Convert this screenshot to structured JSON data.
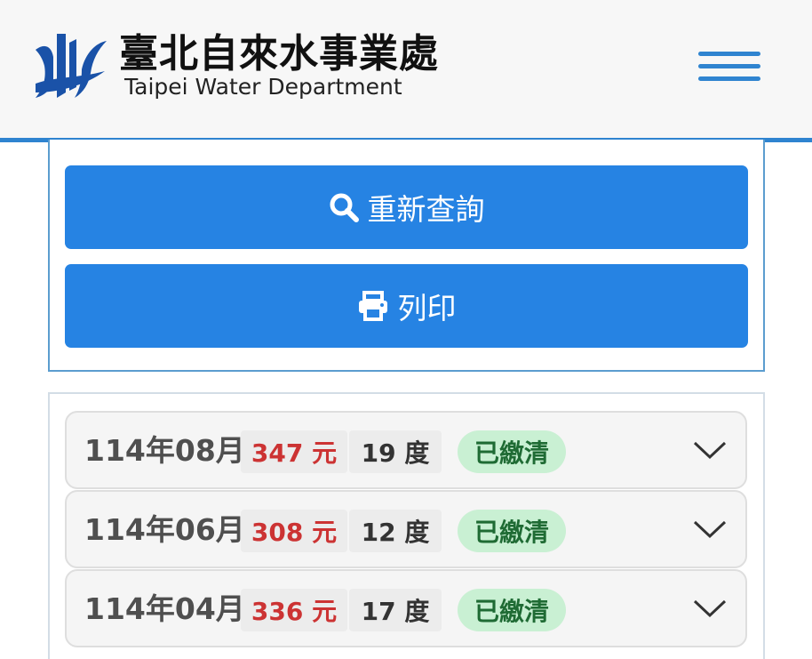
{
  "header": {
    "title_zh": "臺北自來水事業處",
    "title_en": "Taipei Water Department",
    "icons": {
      "logo": "water-department-logo",
      "menu": "hamburger-menu-icon"
    },
    "colors": {
      "accent": "#2f84d0"
    }
  },
  "actions": {
    "search_label": "重新查詢",
    "search_icon": "search-icon",
    "print_label": "列印",
    "print_icon": "printer-icon",
    "button_color": "#2683e3"
  },
  "bills": [
    {
      "month": "114年08月",
      "amount": "347 元",
      "usage": "19 度",
      "status": "已繳清"
    },
    {
      "month": "114年06月",
      "amount": "308 元",
      "usage": "12 度",
      "status": "已繳清"
    },
    {
      "month": "114年04月",
      "amount": "336 元",
      "usage": "17 度",
      "status": "已繳清"
    }
  ],
  "colors": {
    "amount": "#cc3333",
    "status_bg": "#c9f0d3",
    "status_text": "#1f6b34"
  }
}
